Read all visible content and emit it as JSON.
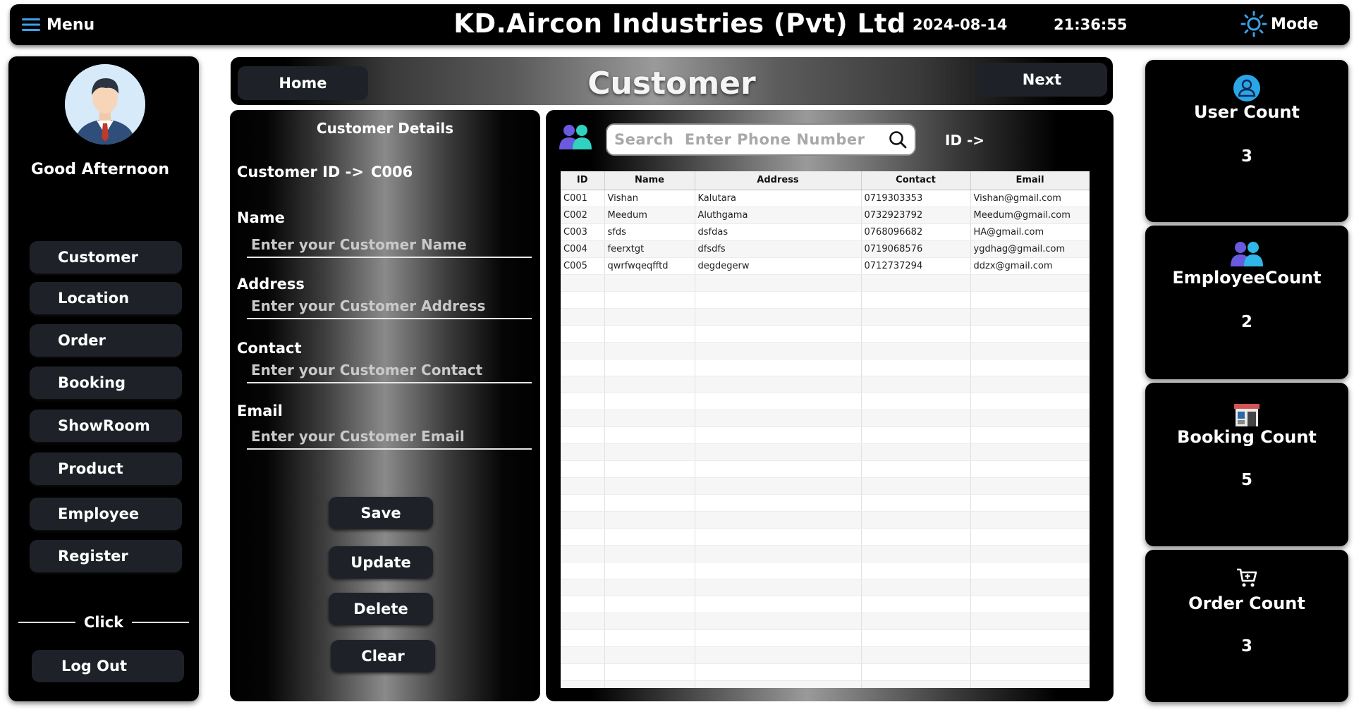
{
  "topbar": {
    "menu_label": "Menu",
    "app_title": "KD.Aircon Industries (Pvt) Ltd",
    "date": "2024-08-14",
    "time": "21:36:55",
    "mode_label": "Mode",
    "menu_icon": "hamburger-icon",
    "mode_icon": "sun-icon"
  },
  "sidebar": {
    "greeting": "Good Afternoon",
    "items": [
      {
        "label": "Customer"
      },
      {
        "label": "Location"
      },
      {
        "label": "Order"
      },
      {
        "label": "Booking"
      },
      {
        "label": "ShowRoom"
      },
      {
        "label": "Product"
      },
      {
        "label": "Employee"
      },
      {
        "label": "Register"
      }
    ],
    "click_label": "Click",
    "logout_label": "Log Out"
  },
  "header": {
    "home_label": "Home",
    "title": "Customer",
    "next_label": "Next"
  },
  "form": {
    "title": "Customer Details",
    "customer_id_label": "Customer ID ->",
    "customer_id_value": "C006",
    "name_label": "Name",
    "name_placeholder": "Enter your Customer Name",
    "address_label": "Address",
    "address_placeholder": "Enter your Customer Address",
    "contact_label": "Contact",
    "contact_placeholder": "Enter your Customer Contact",
    "email_label": "Email",
    "email_placeholder": "Enter your Customer Email",
    "save_label": "Save",
    "update_label": "Update",
    "delete_label": "Delete",
    "clear_label": "Clear"
  },
  "table": {
    "search_placeholder": "Search  Enter Phone Number",
    "id_label": "ID ->",
    "columns": [
      "ID",
      "Name",
      "Address",
      "Contact",
      "Email"
    ],
    "rows": [
      [
        "C001",
        "Vishan",
        "Kalutara",
        "0719303353",
        "Vishan@gmail.com"
      ],
      [
        "C002",
        "Meedum",
        "Aluthgama",
        "0732923792",
        "Meedum@gmail.com"
      ],
      [
        "C003",
        "sfds",
        "dsfdas",
        "0768096682",
        "HA@gmail.com"
      ],
      [
        "C004",
        "feerxtgt",
        "dfsdfs",
        "0719068576",
        "ygdhag@gmail.com"
      ],
      [
        "C005",
        "qwrfwqeqfftd",
        "degdegerw",
        "0712737294",
        "ddzx@gmail.com"
      ]
    ]
  },
  "stats": {
    "user": {
      "title": "User Count",
      "value": "3"
    },
    "employee": {
      "title": "EmployeeCount",
      "value": "2"
    },
    "booking": {
      "title": "Booking Count",
      "value": "5"
    },
    "order": {
      "title": "Order Count",
      "value": "3"
    }
  }
}
